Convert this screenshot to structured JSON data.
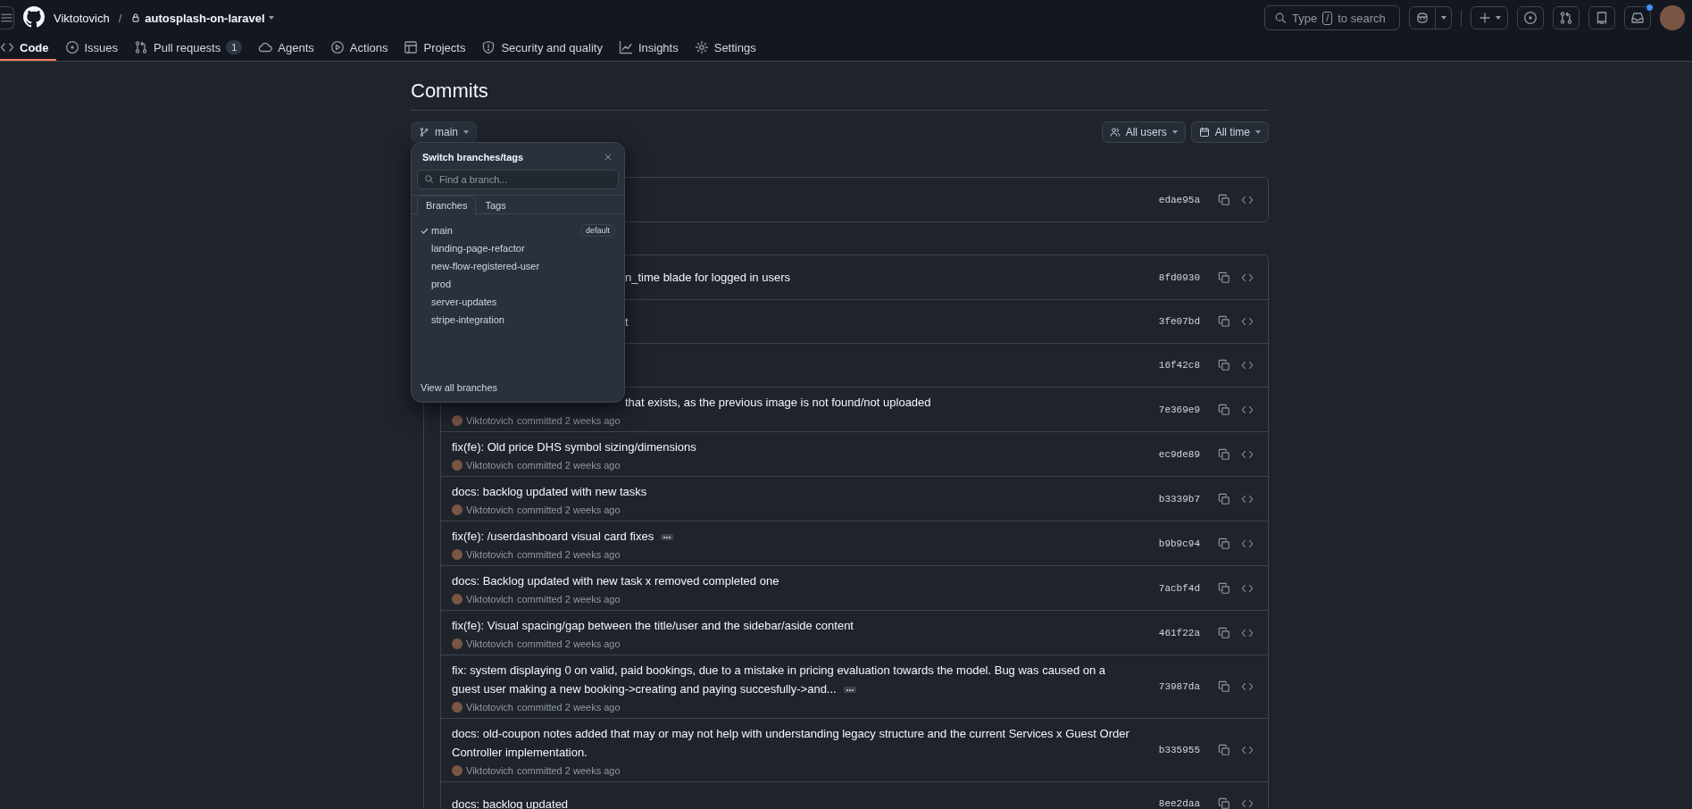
{
  "header": {
    "owner": "Viktotovich",
    "separator": "/",
    "repo": "autosplash-on-laravel",
    "search": {
      "prefix": "Type",
      "key": "/",
      "suffix": "to search"
    },
    "inbox_unread": true
  },
  "nav": {
    "tabs": [
      {
        "label": "Code",
        "selected": true
      },
      {
        "label": "Issues",
        "selected": false
      },
      {
        "label": "Pull requests",
        "counter": "1",
        "selected": false
      },
      {
        "label": "Agents",
        "selected": false
      },
      {
        "label": "Actions",
        "selected": false
      },
      {
        "label": "Projects",
        "selected": false
      },
      {
        "label": "Security and quality",
        "selected": false
      },
      {
        "label": "Insights",
        "selected": false
      },
      {
        "label": "Settings",
        "selected": false
      }
    ]
  },
  "page": {
    "title": "Commits",
    "branch_button": "main",
    "filters": [
      "All users",
      "All time"
    ]
  },
  "groups": [
    {
      "commits": [
        {
          "kind": "hidden",
          "hash": "edae95a"
        }
      ]
    },
    {
      "commits": [
        {
          "kind": "covered",
          "message": "n_time blade for logged in users",
          "hash": "8fd0930"
        },
        {
          "kind": "covered",
          "message": "t",
          "hash": "3fe07bd"
        },
        {
          "kind": "hidden",
          "hash": "16f42c8"
        },
        {
          "kind": "covered",
          "message": "that exists, as the previous image is not found/not uploaded",
          "author": "Viktotovich",
          "when": "committed 2 weeks ago",
          "hash": "7e369e9"
        },
        {
          "kind": "full",
          "message": "fix(fe): Old price DHS symbol sizing/dimensions",
          "author": "Viktotovich",
          "when": "committed 2 weeks ago",
          "hash": "ec9de89"
        },
        {
          "kind": "full",
          "message": "docs: backlog updated with new tasks",
          "author": "Viktotovich",
          "when": "committed 2 weeks ago",
          "hash": "b3339b7"
        },
        {
          "kind": "full",
          "message": "fix(fe): /userdashboard visual card fixes",
          "expandable": true,
          "author": "Viktotovich",
          "when": "committed 2 weeks ago",
          "hash": "b9b9c94"
        },
        {
          "kind": "full",
          "message": "docs: Backlog updated with new task x removed completed one",
          "author": "Viktotovich",
          "when": "committed 2 weeks ago",
          "hash": "7acbf4d"
        },
        {
          "kind": "full",
          "message": "fix(fe): Visual spacing/gap between the title/user and the sidebar/aside content",
          "author": "Viktotovich",
          "when": "committed 2 weeks ago",
          "hash": "461f22a"
        },
        {
          "kind": "full",
          "message": "fix: system displaying 0 on valid, paid bookings, due to a mistake in pricing evaluation towards the model. Bug was caused on a guest user making a new booking->creating and paying succesfully->and...",
          "expandable": true,
          "author": "Viktotovich",
          "when": "committed 2 weeks ago",
          "hash": "73987da"
        },
        {
          "kind": "full",
          "message": "docs: old-coupon notes added that may or may not help with understanding legacy structure and the current Services x Guest Order Controller implementation.",
          "author": "Viktotovich",
          "when": "committed 2 weeks ago",
          "hash": "b335955"
        },
        {
          "kind": "full",
          "message": "docs: backlog updated",
          "hash": "8ee2daa"
        }
      ]
    }
  ],
  "branch_menu": {
    "title": "Switch branches/tags",
    "placeholder": "Find a branch...",
    "tabs": [
      {
        "label": "Branches",
        "selected": true
      },
      {
        "label": "Tags",
        "selected": false
      }
    ],
    "branches": [
      {
        "name": "main",
        "selected": true,
        "badge": "default"
      },
      {
        "name": "landing-page-refactor",
        "selected": false
      },
      {
        "name": "new-flow-registered-user",
        "selected": false
      },
      {
        "name": "prod",
        "selected": false
      },
      {
        "name": "server-updates",
        "selected": false
      },
      {
        "name": "stripe-integration",
        "selected": false
      }
    ],
    "footer": "View all branches"
  }
}
